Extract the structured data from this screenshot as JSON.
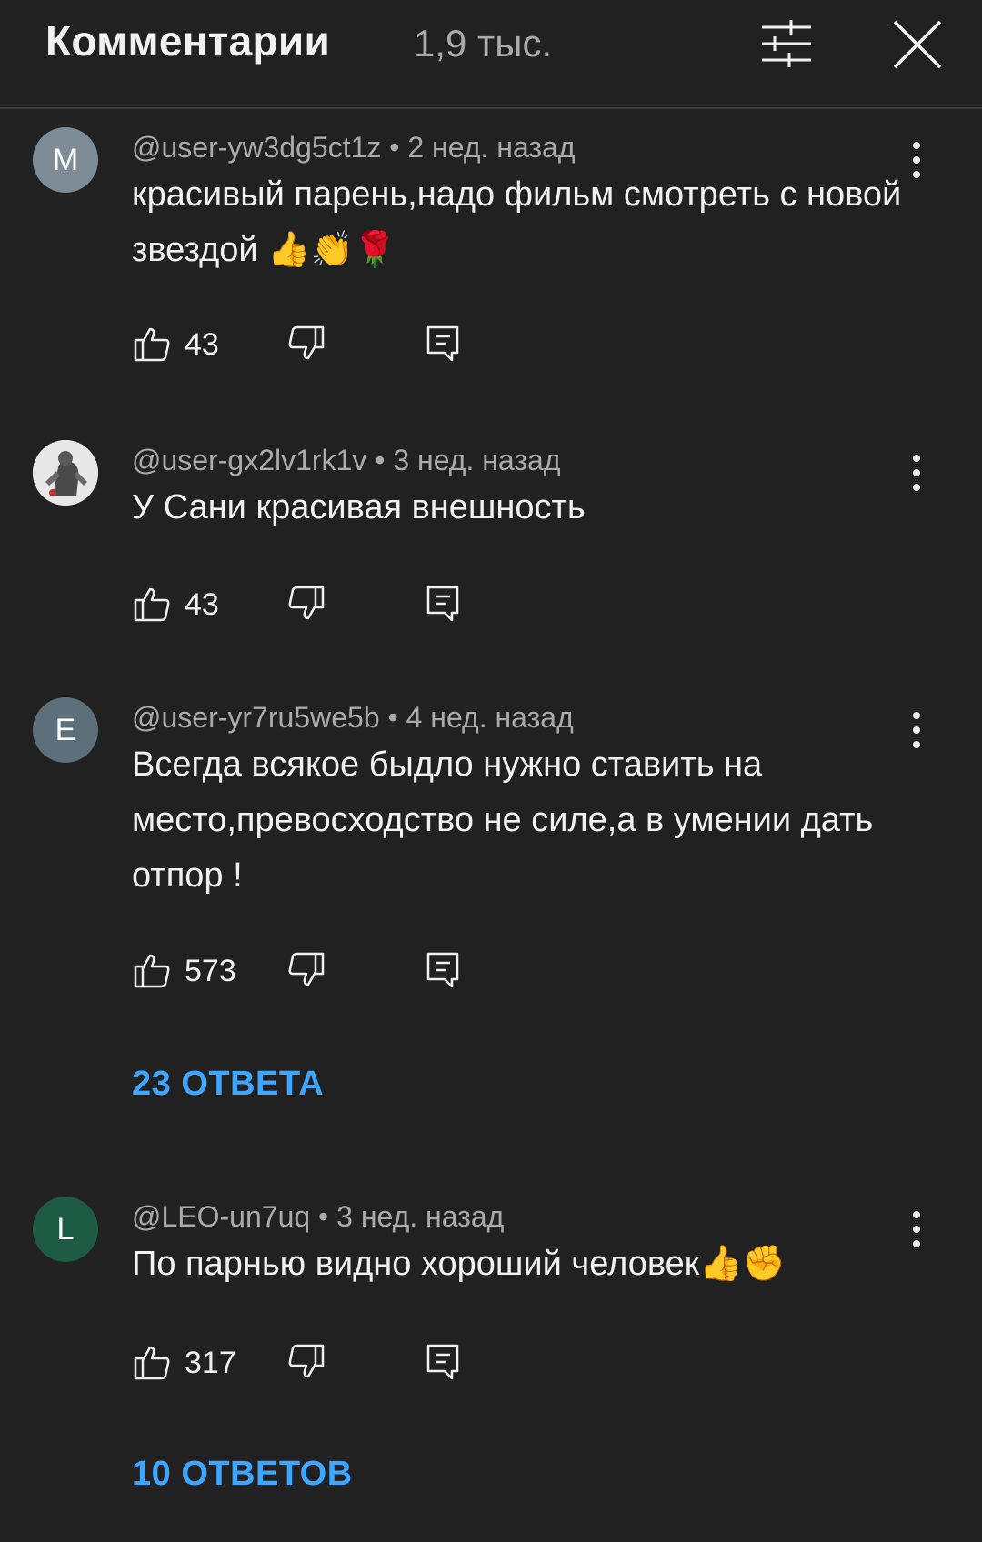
{
  "header": {
    "title": "Комментарии",
    "count": "1,9 тыс."
  },
  "comments": [
    {
      "avatar_letter": "M",
      "avatar_color": "#7d8c96",
      "meta": "@user-yw3dg5ct1z • 2 нед. назад",
      "text": "красивый парень,надо фильм смотреть с новой звездой 👍👏🌹",
      "likes": "43"
    },
    {
      "avatar_letter": "",
      "avatar_color": "#dcdcdc",
      "avatar_icon": "photo-avatar",
      "meta": "@user-gx2lv1rk1v • 3 нед. назад",
      "text": "У Сани красивая внешность",
      "likes": "43"
    },
    {
      "avatar_letter": "E",
      "avatar_color": "#5d6f7a",
      "meta": "@user-yr7ru5we5b • 4 нед. назад",
      "text": "Всегда всякое быдло нужно ставить на место,превосходство  не силе,а  в умении дать отпор !",
      "likes": "573",
      "replies": "23 ОТВЕТА"
    },
    {
      "avatar_letter": "L",
      "avatar_color": "#1e5b45",
      "meta": "@LEO-un7uq • 3 нед. назад",
      "text": "По парнью видно хороший человек👍✊",
      "likes": "317",
      "replies": "10 ОТВЕТОВ"
    }
  ],
  "colors": {
    "background": "#212121",
    "link": "#3ea6ff",
    "secondary_text": "#aaaaaa"
  }
}
